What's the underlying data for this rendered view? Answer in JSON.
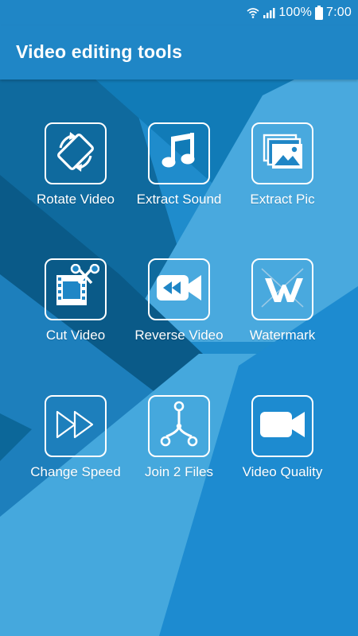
{
  "status_bar": {
    "battery_percent": "100%",
    "time": "7:00",
    "icons": [
      "wifi-icon",
      "signal-icon",
      "battery-icon"
    ]
  },
  "app": {
    "title": "Video editing tools"
  },
  "tools": [
    {
      "label": "Rotate Video",
      "icon": "rotate-icon"
    },
    {
      "label": "Extract Sound",
      "icon": "music-note-icon"
    },
    {
      "label": "Extract Pic",
      "icon": "pictures-icon"
    },
    {
      "label": "Cut Video",
      "icon": "film-scissors-icon"
    },
    {
      "label": "Reverse Video",
      "icon": "rewind-camera-icon"
    },
    {
      "label": "Watermark",
      "icon": "watermark-icon"
    },
    {
      "label": "Change Speed",
      "icon": "fast-forward-icon"
    },
    {
      "label": "Join 2 Files",
      "icon": "merge-icon"
    },
    {
      "label": "Video Quality",
      "icon": "video-camera-icon"
    }
  ],
  "colors": {
    "primary": "#1f86c6",
    "background_dark": "#0c5f8f",
    "background_light": "#4aa9dd",
    "icon_white": "#ffffff"
  }
}
